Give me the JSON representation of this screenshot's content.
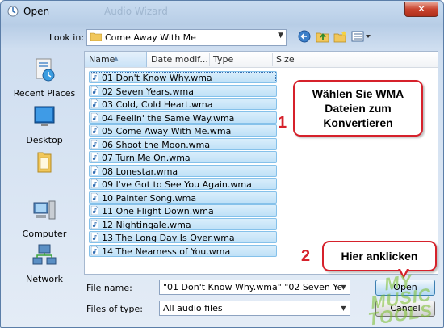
{
  "window": {
    "title": "Open",
    "title_ghost": "Audio Wizard",
    "close_label": "✕"
  },
  "lookin": {
    "label": "Look in:",
    "value": "Come Away With Me"
  },
  "places": [
    {
      "label": "Recent Places",
      "icon": "recent-places-icon"
    },
    {
      "label": "Desktop",
      "icon": "desktop-icon"
    },
    {
      "label": "",
      "icon": "user-folder-icon"
    },
    {
      "label": "Computer",
      "icon": "computer-icon"
    },
    {
      "label": "Network",
      "icon": "network-icon"
    }
  ],
  "columns": {
    "name": "Name",
    "date": "Date modif...",
    "type": "Type",
    "size": "Size"
  },
  "files": [
    "01 Don't Know Why.wma",
    "02 Seven Years.wma",
    "03 Cold, Cold Heart.wma",
    "04 Feelin' the Same Way.wma",
    "05 Come Away With Me.wma",
    "06 Shoot the Moon.wma",
    "07 Turn Me On.wma",
    "08 Lonestar.wma",
    "09 I've Got to See You Again.wma",
    "10 Painter Song.wma",
    "11 One Flight Down.wma",
    "12 Nightingale.wma",
    "13 The Long Day Is Over.wma",
    "14 The Nearness of You.wma"
  ],
  "annotations": {
    "step1_number": "1",
    "step1_text_line1": "Wählen Sie WMA",
    "step1_text_line2": "Dateien zum",
    "step1_text_line3": "Konvertieren",
    "step2_number": "2",
    "step2_text": "Hier anklicken"
  },
  "filename": {
    "label": "File name:",
    "value": "\"01 Don't Know Why.wma\" \"02 Seven Years.w"
  },
  "filetype": {
    "label": "Files of type:",
    "value": "All audio files"
  },
  "buttons": {
    "open": "Open",
    "cancel": "Cancel"
  },
  "watermark": {
    "line1": "MY",
    "line2": "MUSIC",
    "line3": "TOOLS"
  },
  "colors": {
    "accent_red": "#d6212b",
    "selection": "#bfe1f7"
  }
}
